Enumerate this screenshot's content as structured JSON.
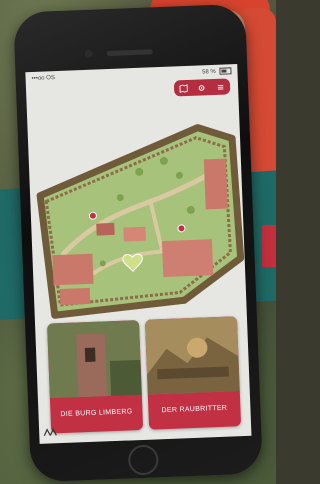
{
  "status_bar": {
    "carrier": "•••oo OS",
    "battery": "58 %"
  },
  "app": {
    "header_icons": [
      "map-icon",
      "settings-icon",
      "menu-icon"
    ],
    "accent_color": "#c23044"
  },
  "cards": [
    {
      "label": "DIE BURG LIMBERG"
    },
    {
      "label": "DER RAUBRITTER"
    }
  ]
}
